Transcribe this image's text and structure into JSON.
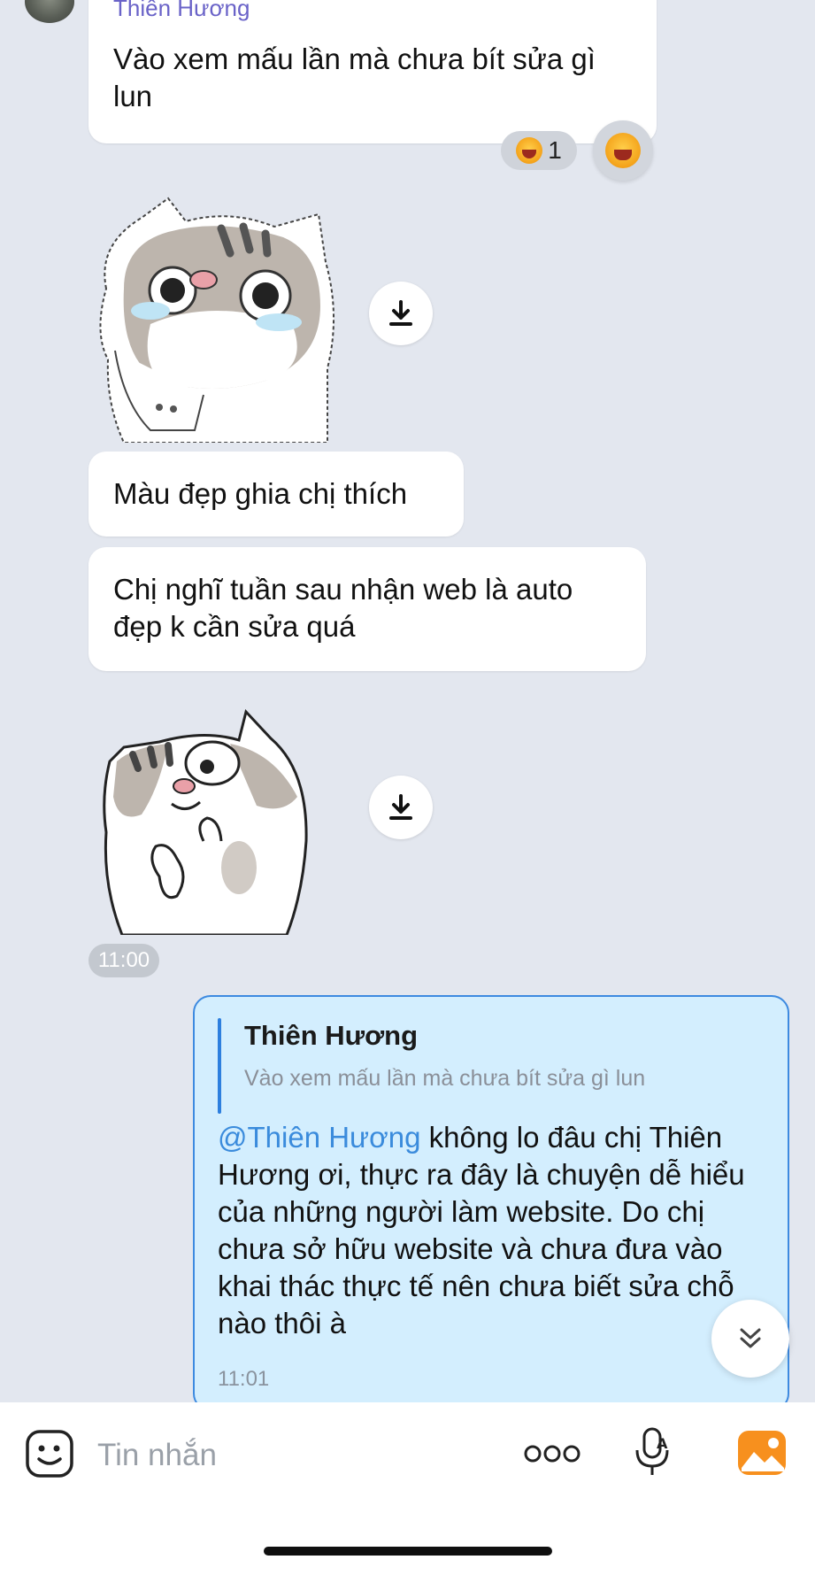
{
  "messages": {
    "first": {
      "sender": "Thiên Hương",
      "text": "Vào xem mấu lần mà chưa bít sửa gì lun",
      "reaction_count": "1"
    },
    "second": {
      "text": "Màu đẹp ghia chị thích"
    },
    "third": {
      "text": "Chị nghĩ tuần sau nhận web là auto đẹp k cần sửa quá"
    },
    "time_divider": "11:00",
    "mine": {
      "quote_name": "Thiên Hương",
      "quote_text": "Vào xem mấu lần mà chưa bít sửa gì lun",
      "mention": "@Thiên Hương",
      "text": " không lo đâu chị Thiên Hương ơi, thực ra đây là chuyện dễ hiểu của những người làm website. Do chị chưa sở hữu website và chưa đưa vào khai thác thực tế nên chưa biết sửa chỗ nào thôi à",
      "time": "11:01"
    }
  },
  "composer": {
    "placeholder": "Tin nhắn"
  },
  "icons": {
    "emoji": "sticker-face-icon",
    "more": "more-dots-icon",
    "mic": "voice-to-text-icon",
    "photo": "gallery-icon",
    "download": "download-icon",
    "scroll": "scroll-down-icon",
    "reaction": "laughing-emoji-icon"
  },
  "colors": {
    "background": "#e3e7ef",
    "my_bubble": "#d3eefe",
    "my_bubble_border": "#3d8ae0",
    "mention": "#3a8bdc",
    "sender_name": "#6a63c8",
    "gallery_icon": "#f7901e"
  }
}
